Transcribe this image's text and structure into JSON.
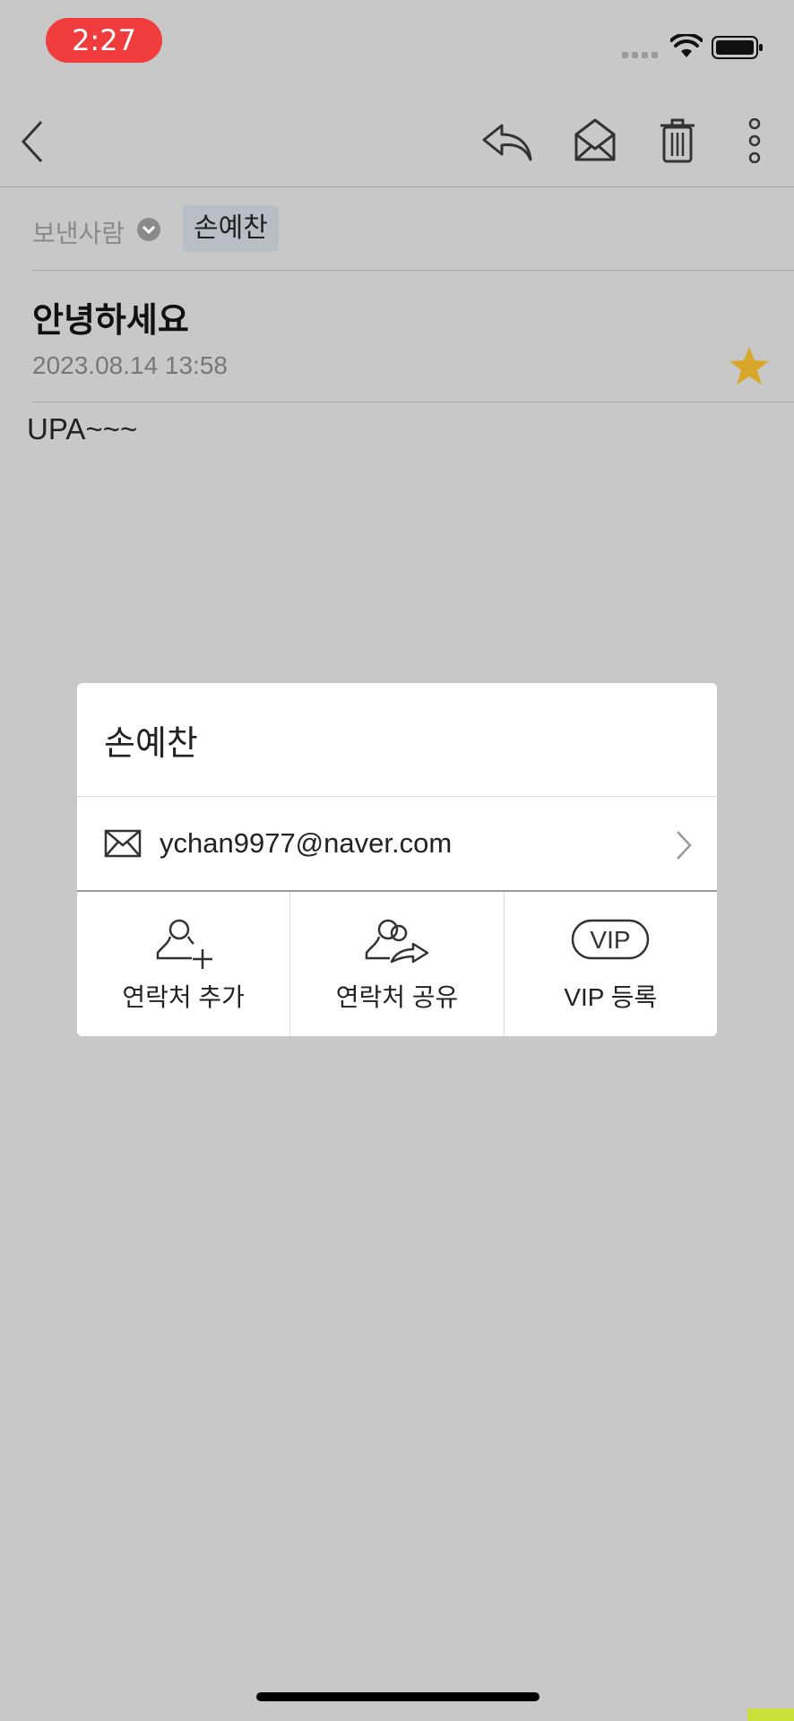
{
  "status": {
    "time": "2:27"
  },
  "toolbar": {
    "back_icon": "back-chevron-icon",
    "reply_icon": "reply-icon",
    "mark_unread_icon": "open-envelope-icon",
    "delete_icon": "trash-icon",
    "more_icon": "more-vertical-icon"
  },
  "mail": {
    "sender_label": "보낸사람",
    "sender_name": "손예찬",
    "subject": "안녕하세요",
    "date": "2023.08.14 13:58",
    "starred": true,
    "body": "UPA~~~"
  },
  "popup": {
    "name": "손예찬",
    "email": "ychan9977@naver.com",
    "actions": [
      {
        "label": "연락처 추가",
        "icon": "add-contact-icon"
      },
      {
        "label": "연락처 공유",
        "icon": "share-contact-icon"
      },
      {
        "label": "VIP 등록",
        "icon": "vip-icon",
        "icon_text": "VIP"
      }
    ]
  },
  "colors": {
    "overlay_bg": "#c8c8c8",
    "time_pill": "#f03c3c",
    "star": "#d8a72a",
    "chip": "#b7bec6"
  }
}
